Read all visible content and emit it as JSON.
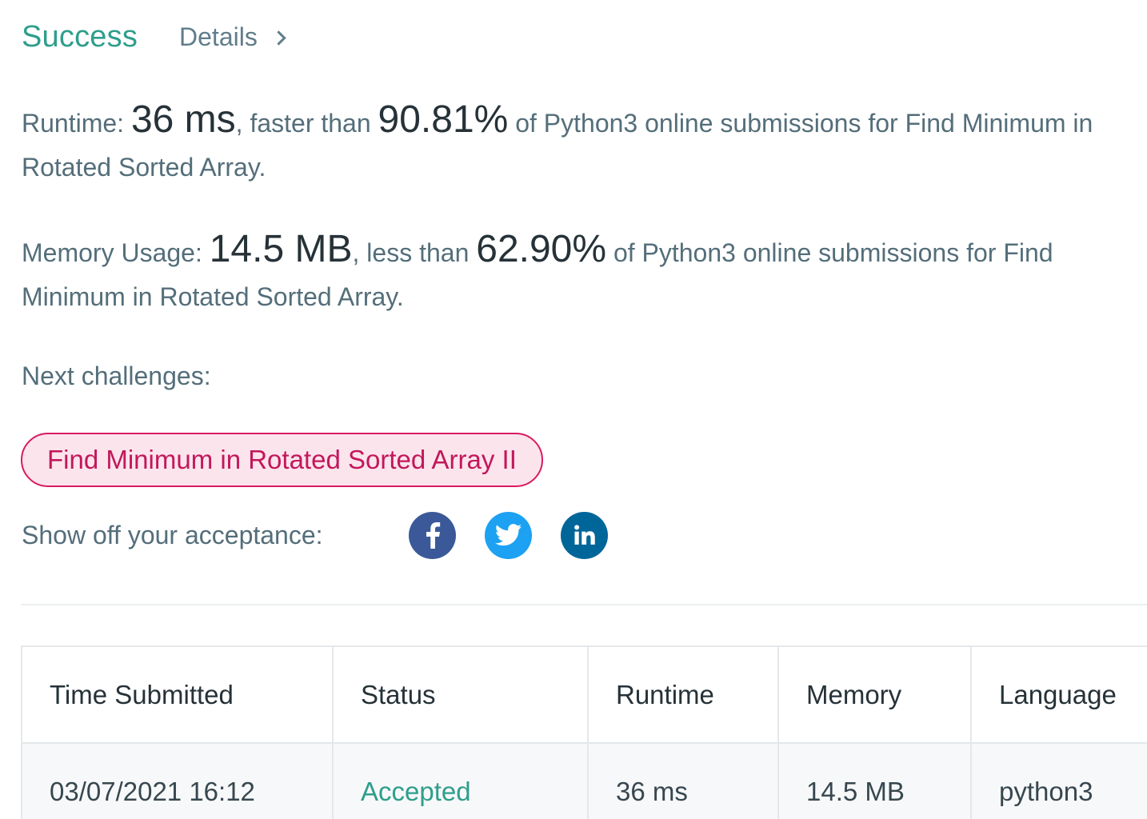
{
  "header": {
    "status": "Success",
    "details_label": "Details"
  },
  "runtime": {
    "label": "Runtime: ",
    "value": "36 ms",
    "comparison": ", faster than ",
    "percent": "90.81%",
    "suffix": " of Python3 online submissions for Find Minimum in Rotated Sorted Array."
  },
  "memory": {
    "label": "Memory Usage: ",
    "value": "14.5 MB",
    "comparison": ", less than ",
    "percent": "62.90%",
    "suffix": " of Python3 online submissions for Find Minimum in Rotated Sorted Array."
  },
  "next": {
    "label": "Next challenges:",
    "challenges": [
      "Find Minimum in Rotated Sorted Array II"
    ]
  },
  "share": {
    "label": "Show off your acceptance:",
    "networks": [
      "facebook-icon",
      "twitter-icon",
      "linkedin-icon"
    ],
    "colors": {
      "facebook": "#3b5998",
      "twitter": "#1da1f2",
      "linkedin": "#006699"
    }
  },
  "table": {
    "columns": [
      "Time Submitted",
      "Status",
      "Runtime",
      "Memory",
      "Language"
    ],
    "rows": [
      {
        "time": "03/07/2021 16:12",
        "status": "Accepted",
        "runtime": "36 ms",
        "memory": "14.5 MB",
        "language": "python3"
      }
    ]
  },
  "colors": {
    "success": "#2e9e8c",
    "pill_border": "#d81b60",
    "pill_bg": "#fce4ec"
  }
}
